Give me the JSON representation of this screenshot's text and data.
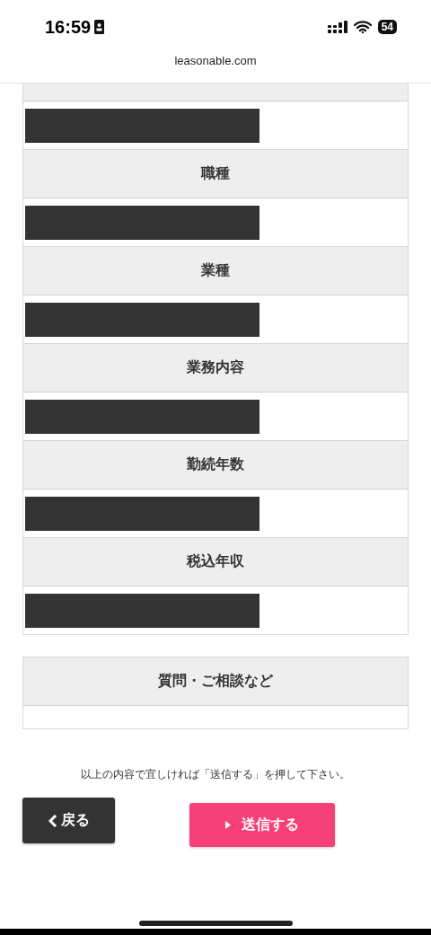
{
  "status_bar": {
    "time": "16:59",
    "battery": "54"
  },
  "address_bar": {
    "url": "leasonable.com"
  },
  "fields": [
    {
      "label": "職種"
    },
    {
      "label": "業種"
    },
    {
      "label": "業務内容"
    },
    {
      "label": "勤続年数"
    },
    {
      "label": "税込年収"
    }
  ],
  "inquiry": {
    "label": "質問・ご相談など"
  },
  "notice": "以上の内容で宜しければ「送信する」を押して下さい。",
  "buttons": {
    "back": "戻る",
    "submit": "送信する"
  }
}
